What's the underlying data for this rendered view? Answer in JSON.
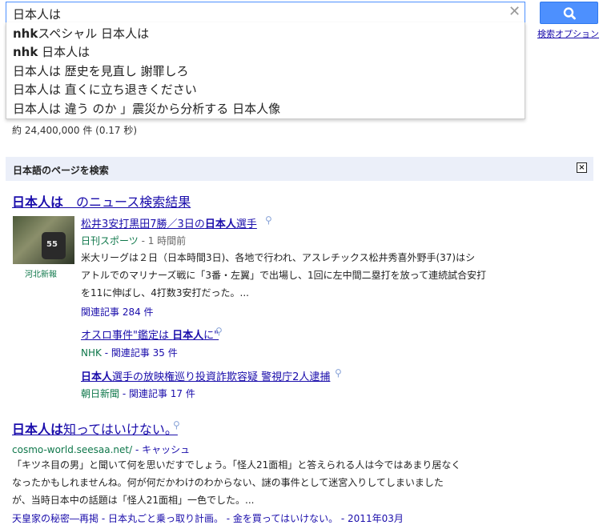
{
  "search": {
    "query": "日本人は",
    "clear_icon": "close-icon",
    "button_icon": "search-icon",
    "options_label": "検索オプション"
  },
  "suggestions": [
    {
      "pre": "nhk",
      "rest": "スペシャル 日本人は"
    },
    {
      "pre": "nhk",
      "rest": " 日本人は"
    },
    {
      "pre": "",
      "rest": "日本人は 歴史を見直し 謝罪しろ"
    },
    {
      "pre": "",
      "rest": "日本人は 直くに立ち退きください"
    },
    {
      "pre": "",
      "rest": "日本人は 違う のか 」震災から分析する 日本人像"
    }
  ],
  "stats": "約 24,400,000 件 (0.17 秒)",
  "jp_bar": {
    "title": "日本語のページを検索",
    "close": "×"
  },
  "news_block": {
    "title_bold": "日本人は",
    "title_rest": "　のニュース検索結果",
    "thumb_caption": "河北新報",
    "thumb_number": "55",
    "items": [
      {
        "link_pre": "松井3安打黒田7勝／3日の",
        "link_bold": "日本人",
        "link_post": "選手",
        "source": "日刊スポーツ",
        "time": " - 1 時間前",
        "snippet": [
          "米大リーグは２日（日本時間3日)、各地で行われ、アスレチックス松井秀喜外野手(37)はシ",
          "アトルでのマリナーズ戦に「3番・左翼」で出場し、1回に左中間二塁打を放って連続試合安打",
          "を11に伸ばし、4打数3安打だった。..."
        ],
        "related": "関連記事 284 件"
      },
      {
        "link_pre": "オスロ事件\"鑑定は ",
        "link_bold": "日本人",
        "link_post": "に\"",
        "source": "NHK",
        "related": " - 関連記事 35 件"
      },
      {
        "link_pre": "",
        "link_bold": "日本人",
        "link_post": "選手の放映権巡り投資詐欺容疑 警視庁2人逮捕",
        "source": "朝日新聞",
        "related": " - 関連記事 17 件"
      }
    ]
  },
  "result2": {
    "title_bold": "日本人は",
    "title_rest": "知ってはいけない。",
    "url": "cosmo-world.seesaa.net/",
    "cache": " - キャッシュ",
    "snippet": [
      "「キツネ目の男」と聞いて何を思いだすでしょう。「怪人21面相」と答えられる人は今ではあまり居なく",
      "なったかもしれませんね。何が何だかわけのわからない、謎の事件として迷宮入りしてしまいました",
      "が、当時日本中の話題は「怪人21面相」一色でした。..."
    ],
    "sitelinks": "天皇家の秘密―再掲 - 日本丸ごと乗っ取り計画。 - 金を買ってはいけない。 - 2011年03月"
  }
}
